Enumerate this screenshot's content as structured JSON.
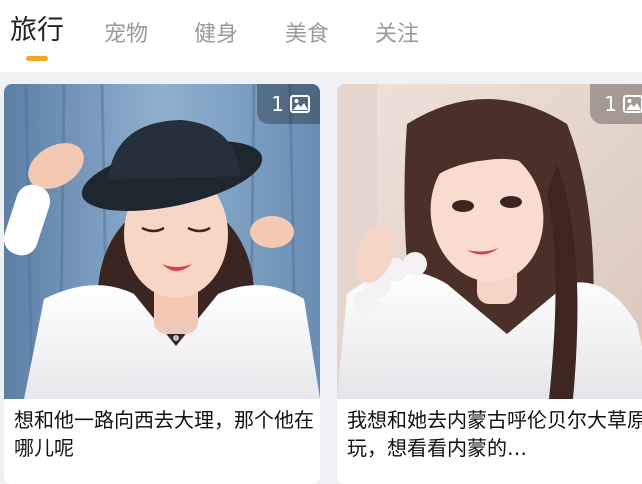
{
  "tabs": [
    {
      "label": "旅行",
      "active": true
    },
    {
      "label": "宠物",
      "active": false
    },
    {
      "label": "健身",
      "active": false
    },
    {
      "label": "美食",
      "active": false
    },
    {
      "label": "关注",
      "active": false
    }
  ],
  "accent_color": "#f5a623",
  "cards": [
    {
      "image_count": "1",
      "count_icon": "image-icon",
      "caption": "想和他一路向西去大理，那个他在哪儿呢"
    },
    {
      "image_count": "1",
      "count_icon": "image-icon",
      "caption": "我想和她去内蒙古呼伦贝尔大草原玩，想看看内蒙的…"
    }
  ]
}
